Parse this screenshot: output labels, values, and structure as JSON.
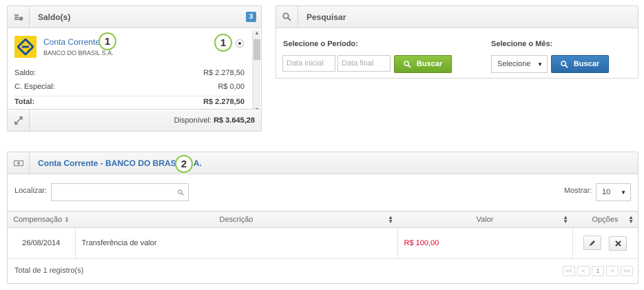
{
  "saldo": {
    "title": "Saldo(s)",
    "badge": "3",
    "account": {
      "name": "Conta Corrente",
      "bank": "BANCO DO BRASIL S.A.",
      "marker": "1"
    },
    "rows": [
      {
        "label": "Saldo:",
        "value": "R$ 2.278,50"
      },
      {
        "label": "C. Especial:",
        "value": "R$ 0,00"
      },
      {
        "label": "Total:",
        "value": "R$ 2.278,50"
      }
    ],
    "footer": {
      "label": "Disponível:",
      "value": "R$ 3.645,28"
    }
  },
  "search": {
    "title": "Pesquisar",
    "period_label": "Selecione o Período:",
    "start_placeholder": "Data inicial",
    "end_placeholder": "Data final",
    "buscar": "Buscar",
    "month_label": "Selecione o Mês:",
    "month_value": "Selecione"
  },
  "conta": {
    "title": "Conta Corrente - BANCO DO BRASIL S.A.",
    "marker": "2",
    "localizar_label": "Localizar:",
    "mostrar_label": "Mostrar:",
    "mostrar_value": "10",
    "columns": {
      "compensacao": "Compensação",
      "descricao": "Descrição",
      "valor": "Valor",
      "opcoes": "Opções"
    },
    "rows": [
      {
        "date": "26/08/2014",
        "description": "Transferência de valor",
        "value": "R$ 100,00"
      }
    ],
    "total": "Total de 1 registro(s)",
    "pager": [
      "<<",
      "<",
      "1",
      ">",
      ">>"
    ]
  },
  "colors": {
    "accent_blue": "#2f6db0",
    "green_button": "#7ab532",
    "blue_button": "#3579b8",
    "negative_value": "#e8002a",
    "marker_green": "#8cc63f"
  }
}
